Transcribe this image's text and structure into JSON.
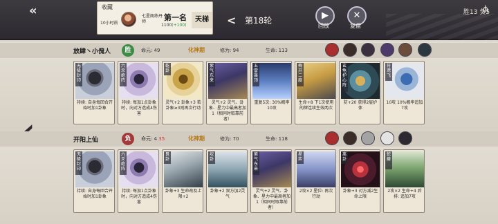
{
  "topbar": {
    "collect": "收藏",
    "time": "10小时前",
    "player_name": "七星阁练丹师",
    "rank": "第一名",
    "score_base": "1100",
    "score_delta": "(+100)",
    "ladder": "天梯",
    "round": "第18轮",
    "replay_label": "回放",
    "review_label": "复盘",
    "record": "胜13 负5"
  },
  "player1": {
    "name": "放肆丶小傀人",
    "badge": "胜",
    "hp_label": "命元:",
    "hp": "49",
    "realm": "化神期",
    "cultivation_label": "修为:",
    "cultivation": "94",
    "life_label": "生命:",
    "life": "113",
    "cards": [
      {
        "title": "无极封印",
        "desc": "持续: 自身每回合开始时加1卦象"
      },
      {
        "title": "六爻绝阵",
        "desc": "持续: 每加1点卦象时，向对方造成4伤害"
      },
      {
        "title": "乾卦",
        "desc": "灵气+2 卦象+3 若卦象≥3则再次行动"
      },
      {
        "title": "紫气东来",
        "desc": "灵气+2 灵气、卦象、星力中最高者加1（相同时取靠前者）"
      },
      {
        "title": "五雷轰顶",
        "desc": "重复5次: 30%概率10攻"
      },
      {
        "title": "梅开二度",
        "desc": "生命+8 下1次使用的牌连续生效两次"
      },
      {
        "title": "玄龟护心阵",
        "desc": "防+20 获得2层护体"
      },
      {
        "title": "符鸢飞",
        "desc": "10攻 10%概率追加7攻"
      }
    ]
  },
  "player2": {
    "name": "开阳上仙",
    "badge": "负",
    "hp_label": "命元:",
    "hp_old": "4",
    "hp": "35",
    "realm": "化神期",
    "cultivation_label": "修为:",
    "cultivation": "70",
    "life_label": "生命:",
    "life": "118",
    "cards": [
      {
        "title": "无极封印",
        "desc": "持续: 自身每回合开始时加1卦象"
      },
      {
        "title": "六爻绝阵",
        "desc": "持续: 每加1点卦象时，向对方造成4伤害"
      },
      {
        "title": "艮卦",
        "desc": "卦象+3 生命改及上限+2"
      },
      {
        "title": "坎卦",
        "desc": "卦象+2 双方加2灵气"
      },
      {
        "title": "紫气东来",
        "desc": "灵气+2 灵气、卦象、星力中最高者加1（相同时取靠前者）"
      },
      {
        "title": "星弈",
        "desc": "2攻×2 星位: 再次行动"
      },
      {
        "title": "离卦",
        "desc": "卦象+3 对方减2生命上限"
      },
      {
        "title": "蛇藤",
        "desc": "2攻×2 生命+4 后排: 追加7攻"
      }
    ]
  },
  "colors": {
    "topbar": "#2c2a30",
    "realm": "#b77a18",
    "win_badge": "#3e8b47",
    "lose_badge": "#a33a3a"
  },
  "icons": [
    "back-arrow-icon",
    "chevron-left-icon",
    "play-icon",
    "close-icon",
    "share-icon",
    "big-left-arrow-icon"
  ]
}
